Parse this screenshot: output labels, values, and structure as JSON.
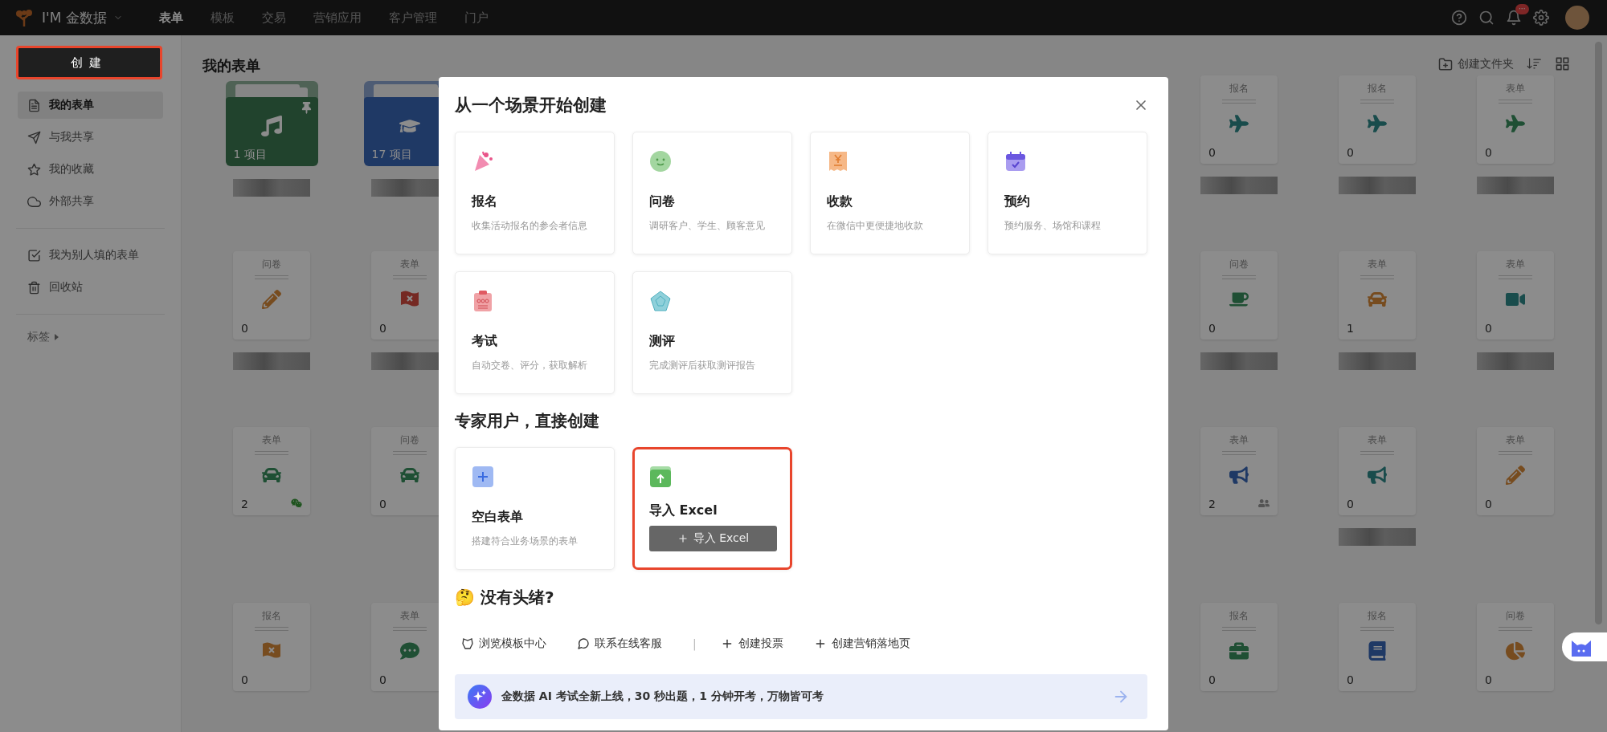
{
  "top_bar": {
    "brand": "I'M 金数据",
    "nav": [
      {
        "label": "表单",
        "selected": true
      },
      {
        "label": "模板",
        "selected": false
      },
      {
        "label": "交易",
        "selected": false
      },
      {
        "label": "营销应用",
        "selected": false
      },
      {
        "label": "客户管理",
        "selected": false
      },
      {
        "label": "门户",
        "selected": false
      }
    ],
    "notification_badge": "···"
  },
  "sidebar": {
    "create_button": "创建",
    "groups": [
      [
        {
          "label": "我的表单",
          "selected": true
        },
        {
          "label": "与我共享",
          "selected": false
        },
        {
          "label": "我的收藏",
          "selected": false
        },
        {
          "label": "外部共享",
          "selected": false
        }
      ],
      [
        {
          "label": "我为别人填的表单",
          "selected": false
        },
        {
          "label": "回收站",
          "selected": false
        }
      ]
    ],
    "tags": "标签"
  },
  "main": {
    "title": "我的表单",
    "create_folder": "创建文件夹",
    "rows": [
      {
        "cards": [
          {
            "kind": "folder",
            "count": "1 项目",
            "pinned": true,
            "name_redacted": true
          },
          {
            "kind": "folder",
            "count": "17 项目",
            "name_redacted": true
          },
          {
            "kind": "form",
            "type": "报名",
            "count": "0",
            "name_redacted": true
          },
          {
            "kind": "form",
            "type": "报名",
            "count": "0",
            "name_redacted": true
          },
          {
            "kind": "form",
            "type": "表单",
            "count": "0",
            "name_redacted": true
          }
        ]
      },
      {
        "cards": [
          {
            "kind": "form",
            "type": "问卷",
            "count": "0",
            "name_redacted": true
          },
          {
            "kind": "form",
            "type": "表单",
            "count": "0",
            "name_redacted": true
          },
          {
            "kind": "form",
            "type": "问卷",
            "count": "0",
            "name_redacted": true
          },
          {
            "kind": "form",
            "type": "表单",
            "count": "1",
            "name_redacted": true
          },
          {
            "kind": "form",
            "type": "表单",
            "count": "0",
            "name_redacted": true
          }
        ]
      },
      {
        "cards": [
          {
            "kind": "form",
            "type": "表单",
            "count": "2",
            "wechat": true
          },
          {
            "kind": "form",
            "type": "问卷",
            "count": "0"
          },
          {
            "kind": "form",
            "type": "表单",
            "count": "2",
            "shared": true
          },
          {
            "kind": "form",
            "type": "表单",
            "count": "0",
            "name_redacted": true
          },
          {
            "kind": "form",
            "type": "表单",
            "count": "0"
          }
        ]
      },
      {
        "cards": [
          {
            "kind": "form",
            "type": "报名",
            "count": "0"
          },
          {
            "kind": "form",
            "type": "表单",
            "count": "0"
          },
          {
            "kind": "form",
            "type": "报名",
            "count": "0"
          },
          {
            "kind": "form",
            "type": "报名",
            "count": "0"
          },
          {
            "kind": "form",
            "type": "问卷",
            "count": "0"
          }
        ]
      }
    ]
  },
  "dialog": {
    "title": "从一个场景开始创建",
    "scenes": [
      {
        "title": "报名",
        "description": "收集活动报名的参会者信息"
      },
      {
        "title": "问卷",
        "description": "调研客户、学生、顾客意见"
      },
      {
        "title": "收款",
        "description": "在微信中更便捷地收款"
      },
      {
        "title": "预约",
        "description": "预约服务、场馆和课程"
      },
      {
        "title": "考试",
        "description": "自动交卷、评分，获取解析"
      },
      {
        "title": "测评",
        "description": "完成测评后获取测评报告"
      }
    ],
    "expert_title": "专家用户，直接创建",
    "expert": [
      {
        "kind": "blank",
        "title": "空白表单",
        "description": "搭建符合业务场景的表单",
        "highlighted": false
      },
      {
        "kind": "import",
        "title": "导入 Excel",
        "button": "导入 Excel",
        "highlighted": true
      }
    ],
    "help_title": "🤔 没有头绪?",
    "links": [
      {
        "kind": "template",
        "label": "浏览模板中心"
      },
      {
        "kind": "chat",
        "label": "联系在线客服"
      },
      {
        "kind": "separator",
        "label": "|"
      },
      {
        "kind": "add",
        "label": "创建投票"
      },
      {
        "kind": "add",
        "label": "创建营销落地页"
      }
    ],
    "banner": "金数据 AI 考试全新上线，30 秒出题，1 分钟开考，万物皆可考"
  }
}
